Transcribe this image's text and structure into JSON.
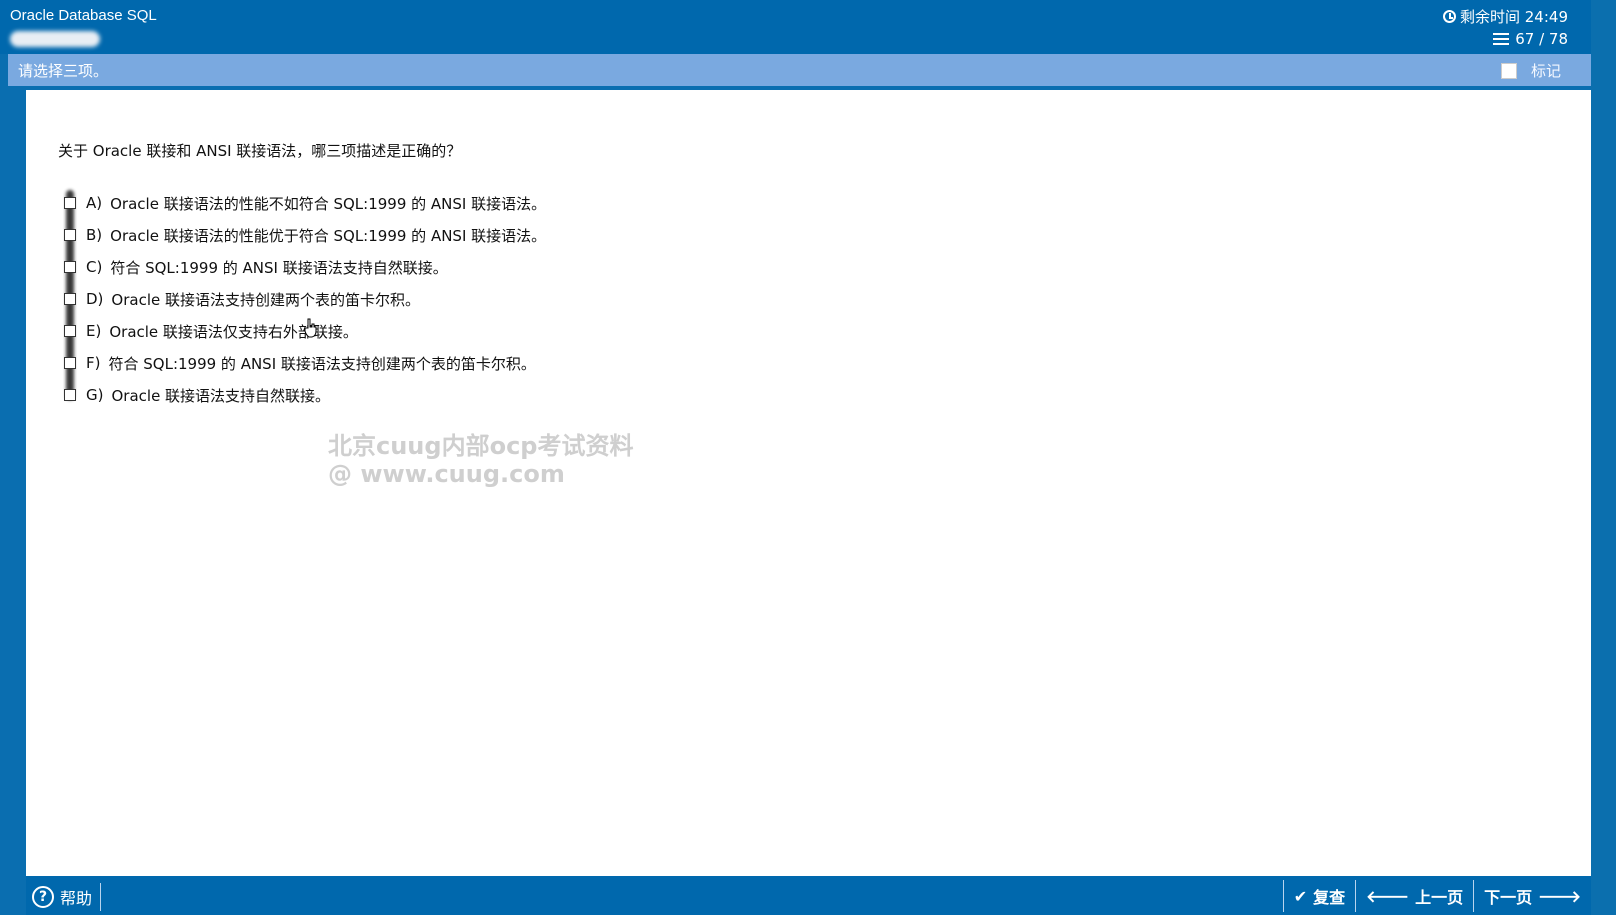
{
  "window": {
    "title": "Oracle Database SQL",
    "timer_label": "剩余时间 24:49",
    "progress_label": "67 / 78"
  },
  "instruction": {
    "text": "请选择三项。",
    "mark_label": "标记"
  },
  "question": {
    "text": "关于 Oracle 联接和 ANSI 联接语法，哪三项描述是正确的？",
    "options": [
      {
        "letter": "A)",
        "text": "Oracle 联接语法的性能不如符合 SQL:1999 的 ANSI 联接语法。"
      },
      {
        "letter": "B)",
        "text": "Oracle 联接语法的性能优于符合 SQL:1999 的 ANSI 联接语法。"
      },
      {
        "letter": "C)",
        "text": "符合 SQL:1999 的 ANSI 联接语法支持自然联接。"
      },
      {
        "letter": "D)",
        "text": "Oracle 联接语法支持创建两个表的笛卡尔积。"
      },
      {
        "letter": "E)",
        "text": "Oracle 联接语法仅支持右外部联接。"
      },
      {
        "letter": "F)",
        "text": "符合 SQL:1999 的 ANSI 联接语法支持创建两个表的笛卡尔积。"
      },
      {
        "letter": "G)",
        "text": "Oracle 联接语法支持自然联接。"
      }
    ]
  },
  "watermark": {
    "line1": "北京cuug内部ocp考试资料",
    "line2": "@ www.cuug.com"
  },
  "bottom": {
    "help_label": "帮助",
    "review_label": "复查",
    "prev_label": "上一页",
    "next_label": "下一页"
  },
  "icons": {
    "clock": "clock-icon",
    "list": "list-icon",
    "help": "help-icon",
    "check": "check-icon",
    "prev": "arrow-left-icon",
    "next": "arrow-right-icon"
  }
}
